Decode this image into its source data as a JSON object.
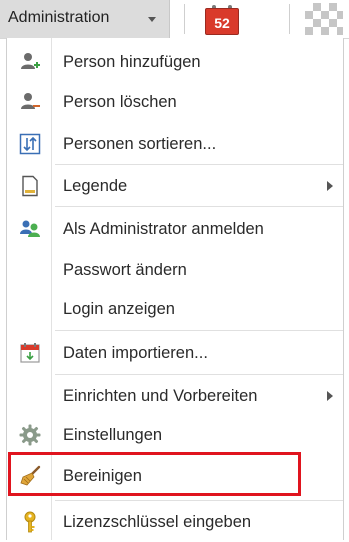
{
  "toolbar": {
    "admin_label": "Administration",
    "calendar_number": "52"
  },
  "menu": {
    "items": [
      {
        "label": "Person hinzufügen",
        "icon": "person-add-icon"
      },
      {
        "label": "Person löschen",
        "icon": "person-remove-icon"
      },
      {
        "label": "Personen sortieren...",
        "icon": "sort-icon"
      },
      {
        "label": "Legende",
        "icon": "document-icon",
        "submenu": true
      },
      {
        "label": "Als Administrator anmelden",
        "icon": "admin-login-icon"
      },
      {
        "label": "Passwort ändern",
        "icon": ""
      },
      {
        "label": "Login anzeigen",
        "icon": ""
      },
      {
        "label": "Daten importieren...",
        "icon": "calendar-import-icon"
      },
      {
        "label": "Einrichten und Vorbereiten",
        "icon": "",
        "submenu": true
      },
      {
        "label": "Einstellungen",
        "icon": "gear-icon"
      },
      {
        "label": "Bereinigen",
        "icon": "broom-icon",
        "highlighted": true
      },
      {
        "label": "Lizenzschlüssel eingeben",
        "icon": "key-icon"
      }
    ]
  },
  "colors": {
    "highlight_border": "#e0141e",
    "calendar_red": "#d93a2b",
    "toolbar_active": "#dcdcdc"
  }
}
